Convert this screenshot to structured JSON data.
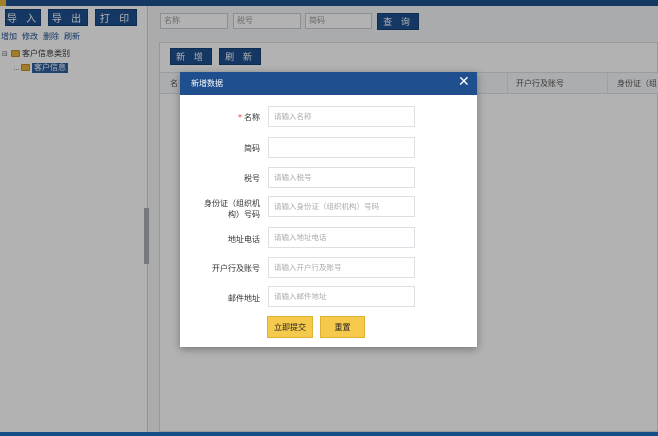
{
  "left": {
    "import_label": "导 入",
    "export_label": "导 出",
    "print_label": "打 印",
    "actions": [
      "增加",
      "修改",
      "删除",
      "刷新"
    ],
    "tree": {
      "root_label": "客户信息类别",
      "root_icon": "folder-icon",
      "child_label": "客户信息"
    }
  },
  "search": {
    "name_placeholder": "名称",
    "tax_placeholder": "税号",
    "short_placeholder": "简码",
    "query_label": "查 询"
  },
  "panel": {
    "add_label": "新 增",
    "refresh_label": "刷 新",
    "columns": [
      "名",
      "开户行及账号",
      "身份证（组"
    ]
  },
  "modal": {
    "title": "新增数据",
    "close_symbol": "✕",
    "fields": [
      {
        "label": "名称",
        "required": "*",
        "placeholder": "请输入名称"
      },
      {
        "label": "简码",
        "placeholder": ""
      },
      {
        "label": "税号",
        "placeholder": "请输入税号"
      },
      {
        "label": "身份证（组织机构）号码",
        "label_line1": "身份证（组织机",
        "label_line2": "构）号码",
        "placeholder": "请输入身份证（组织机构）号码"
      },
      {
        "label": "地址电话",
        "placeholder": "请输入地址电话"
      },
      {
        "label": "开户行及账号",
        "placeholder": "请输入开户行及账号"
      },
      {
        "label": "邮件地址",
        "placeholder": "请输入邮件地址"
      }
    ],
    "submit_label": "立即提交",
    "reset_label": "重置"
  },
  "colors": {
    "primary": "#1f4f8f",
    "accent_button": "#f5c94b",
    "required": "#e23a3a"
  }
}
